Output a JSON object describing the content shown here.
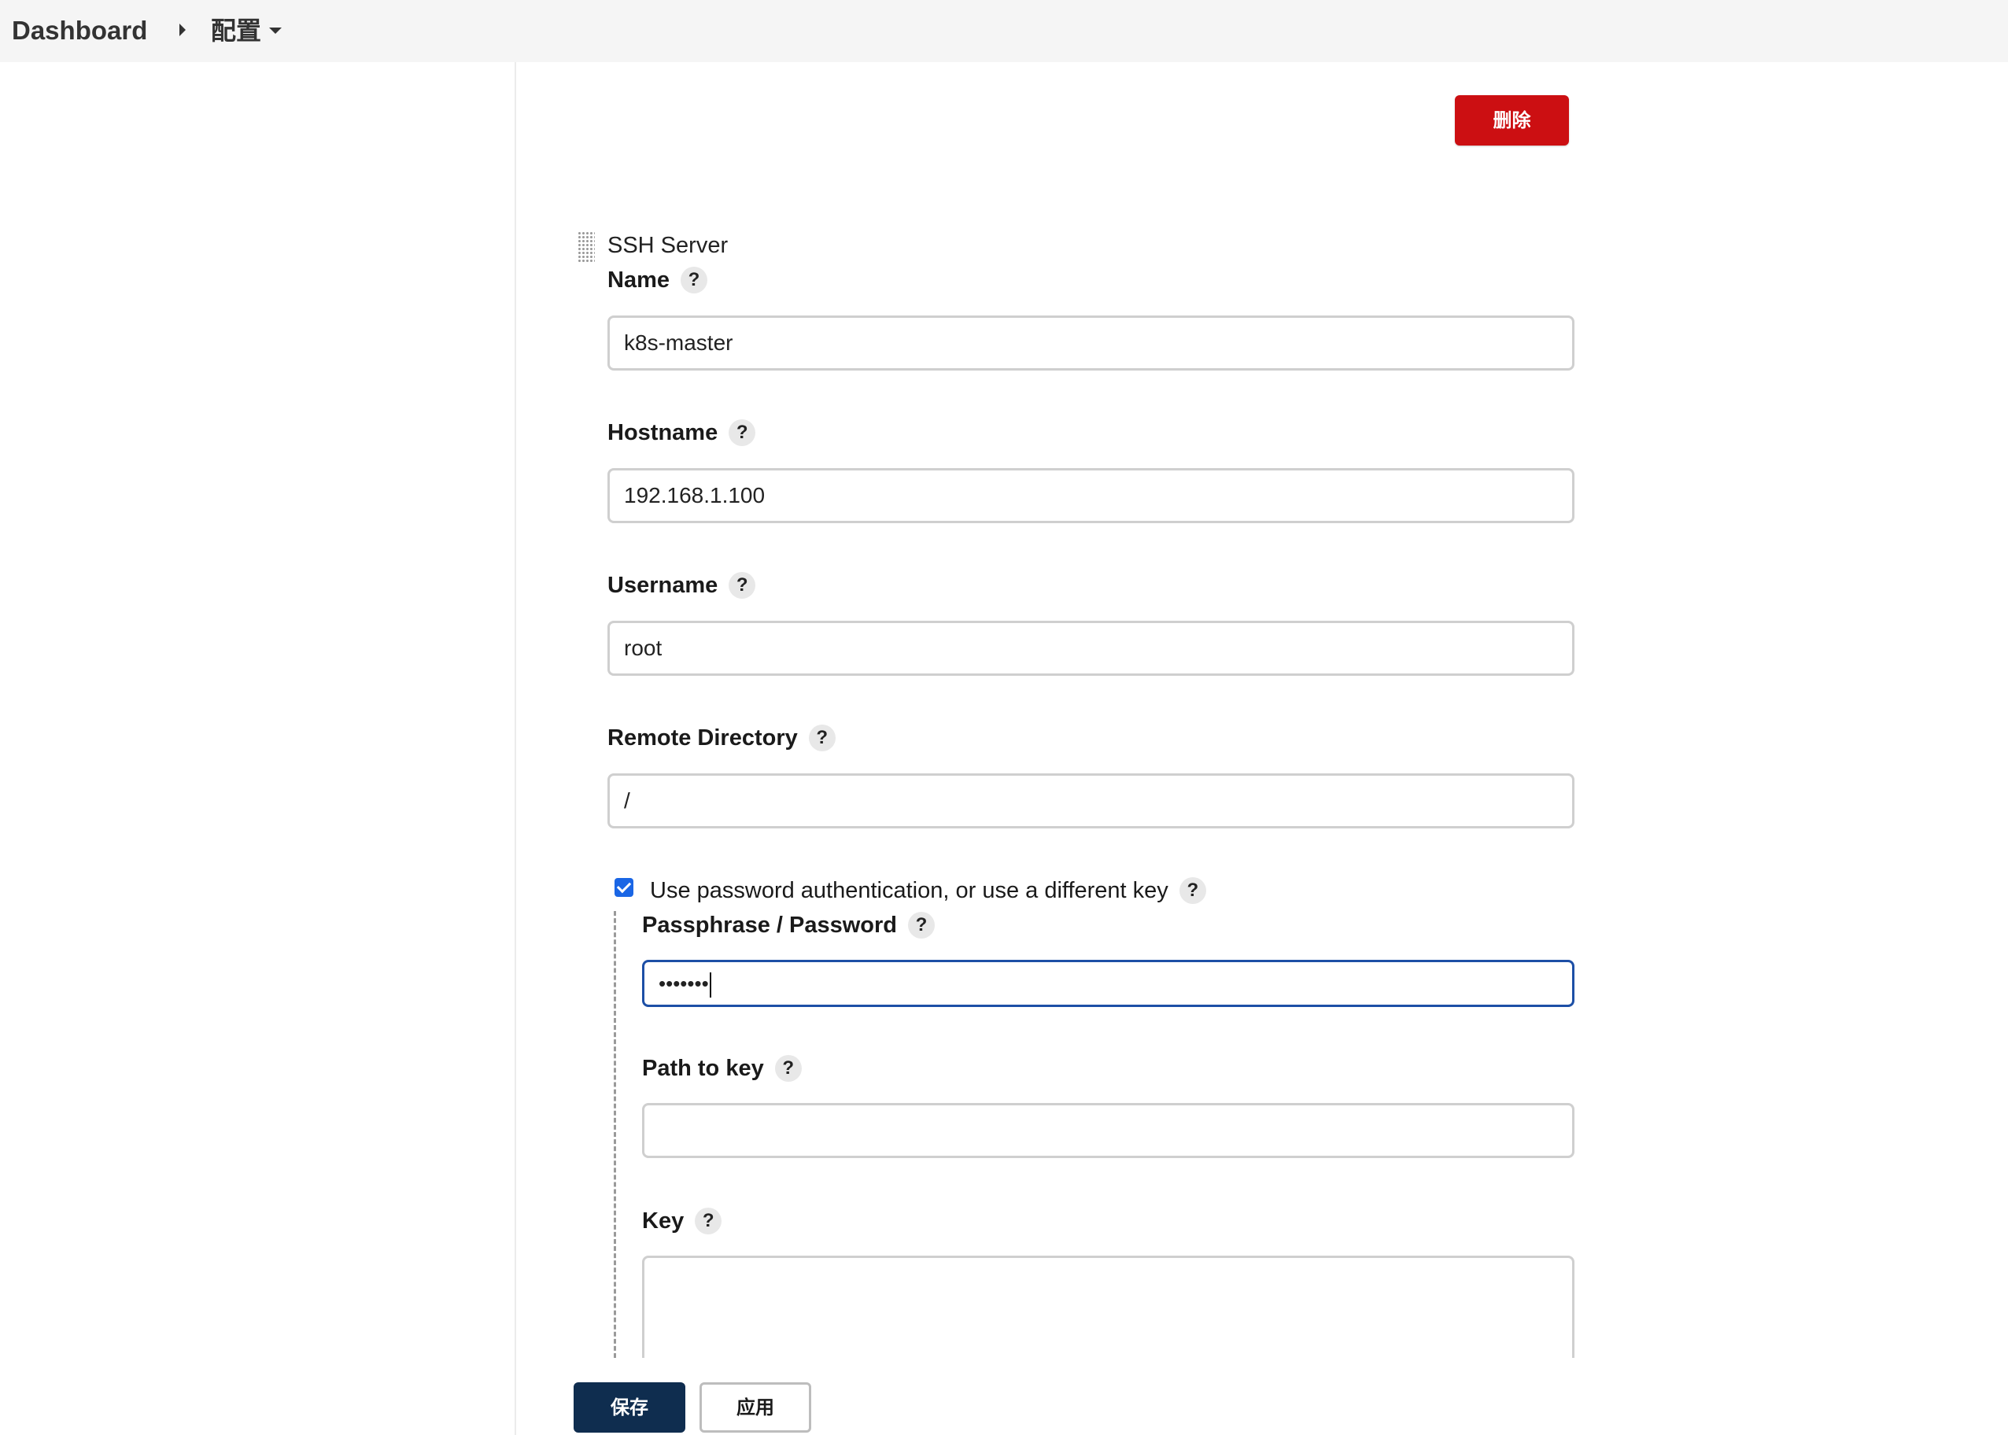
{
  "breadcrumb": {
    "dashboard": "Dashboard",
    "config": "配置"
  },
  "actions": {
    "delete_label": "删除",
    "save_label": "保存",
    "apply_label": "应用"
  },
  "section": {
    "title": "SSH Server"
  },
  "help_glyph": "?",
  "fields": {
    "name": {
      "label": "Name",
      "value": "k8s-master"
    },
    "hostname": {
      "label": "Hostname",
      "value": "192.168.1.100"
    },
    "username": {
      "label": "Username",
      "value": "root"
    },
    "remote_directory": {
      "label": "Remote Directory",
      "value": "/"
    },
    "use_password": {
      "label": "Use password authentication, or use a different key",
      "checked": true
    },
    "passphrase": {
      "label": "Passphrase / Password",
      "masked_value": "•••••••"
    },
    "path_to_key": {
      "label": "Path to key",
      "value": ""
    },
    "key": {
      "label": "Key",
      "value": ""
    }
  },
  "colors": {
    "delete_button": "#cc0f12",
    "save_button": "#0f2d4f",
    "focus_border": "#1d4fa6",
    "checkbox": "#1a66e5"
  },
  "icons": {
    "breadcrumb_separator": "caret-right-icon",
    "config_dropdown": "caret-down-icon",
    "drag_handle": "drag-handle-icon",
    "help": "help-icon",
    "checkbox_check": "checkmark-icon"
  }
}
